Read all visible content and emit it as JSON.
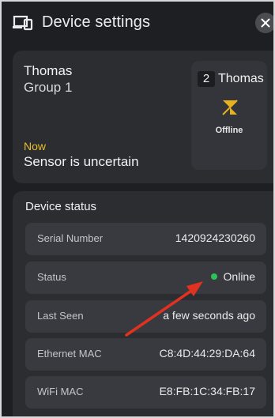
{
  "header": {
    "title": "Device settings",
    "device_icon": "devices-icon",
    "close_icon": "close-icon"
  },
  "device": {
    "name": "Thomas",
    "group": "Group 1",
    "time_label": "Now",
    "message": "Sensor is uncertain",
    "accent_color": "#e6bf2a"
  },
  "tile": {
    "number": "2",
    "name": "Thomas",
    "state_icon": "offline-sensor-icon",
    "state_label": "Offline",
    "icon_color": "#e8b21f"
  },
  "status_section": {
    "heading": "Device status",
    "rows": [
      {
        "label": "Serial Number",
        "value": "1420924230260"
      },
      {
        "label": "Status",
        "value": "Online",
        "indicator_color": "#29c25b"
      },
      {
        "label": "Last Seen",
        "value": "a few seconds ago"
      },
      {
        "label": "Ethernet MAC",
        "value": "C8:4D:44:29:DA:64"
      },
      {
        "label": "WiFi MAC",
        "value": "E8:FB:1C:34:FB:17"
      }
    ]
  },
  "annotation": {
    "arrow_color": "#e0321f"
  }
}
